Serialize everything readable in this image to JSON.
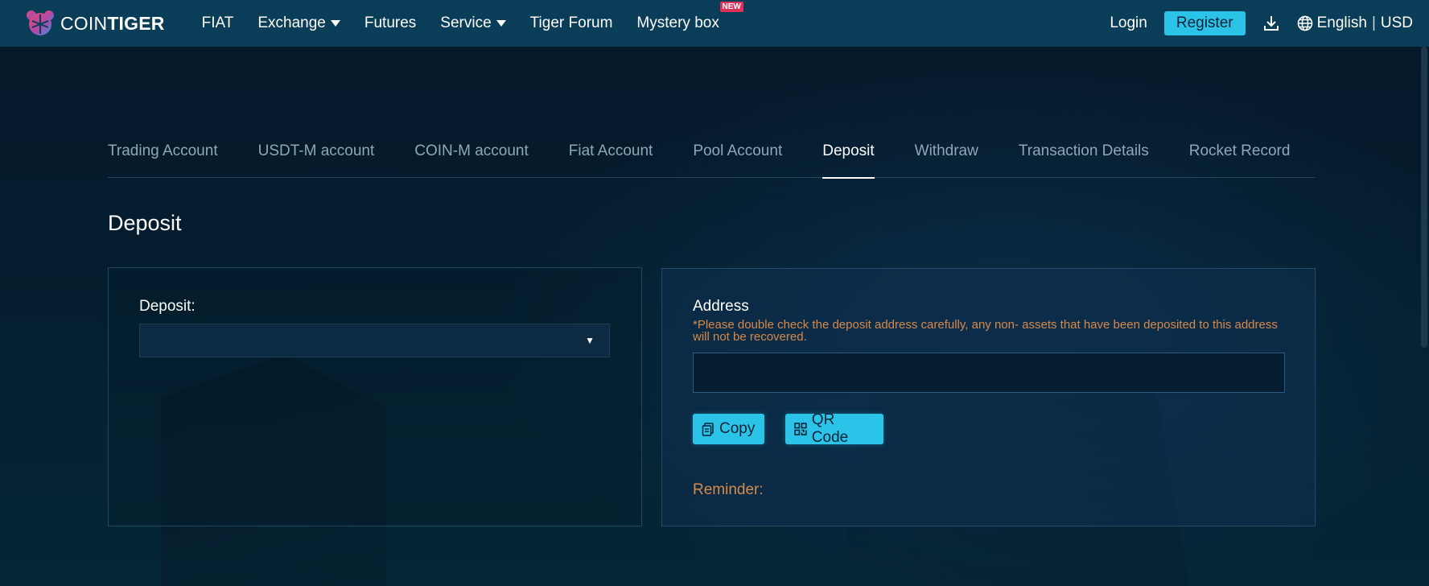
{
  "brand": {
    "name_light": "COIN",
    "name_bold": "TIGER",
    "logo_icon": "tiger-logo-icon"
  },
  "nav": {
    "items": [
      {
        "label": "FIAT",
        "dropdown": false
      },
      {
        "label": "Exchange",
        "dropdown": true
      },
      {
        "label": "Futures",
        "dropdown": false
      },
      {
        "label": "Service",
        "dropdown": true
      },
      {
        "label": "Tiger Forum",
        "dropdown": false
      },
      {
        "label": "Mystery box",
        "dropdown": false,
        "badge": "NEW"
      }
    ]
  },
  "header_right": {
    "login": "Login",
    "register": "Register",
    "download_icon": "download-icon",
    "language": "English",
    "currency": "USD",
    "separator": "|"
  },
  "tabs": [
    {
      "label": "Trading Account",
      "active": false
    },
    {
      "label": "USDT-M account",
      "active": false
    },
    {
      "label": "COIN-M account",
      "active": false
    },
    {
      "label": "Fiat Account",
      "active": false
    },
    {
      "label": "Pool Account",
      "active": false
    },
    {
      "label": "Deposit",
      "active": true
    },
    {
      "label": "Withdraw",
      "active": false
    },
    {
      "label": "Transaction Details",
      "active": false
    },
    {
      "label": "Rocket Record",
      "active": false
    }
  ],
  "page_title": "Deposit",
  "deposit_panel": {
    "label": "Deposit:",
    "select_value": "",
    "arrow": "▼"
  },
  "address_panel": {
    "label": "Address",
    "warning": "*Please double check the deposit address carefully, any non- assets that have been deposited to this address will not be recovered.",
    "address_value": "",
    "copy_label": "Copy",
    "qr_label": "QR Code",
    "reminder": "Reminder:"
  },
  "colors": {
    "header_bg": "#0a3d57",
    "accent": "#2cc3e8",
    "warning": "#d7894a",
    "badge": "#e0315c",
    "tab_inactive": "#8ea8b8"
  }
}
